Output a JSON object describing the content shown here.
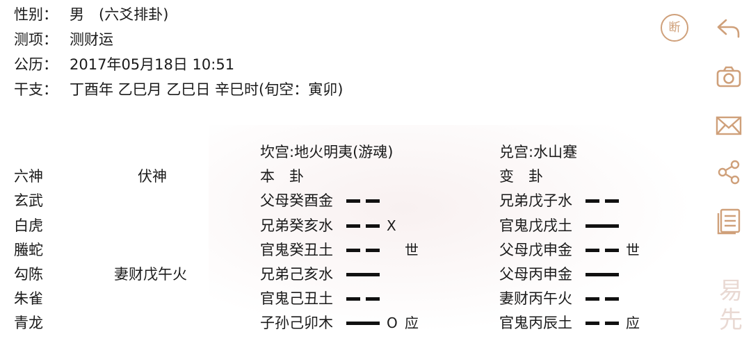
{
  "info": {
    "gender": {
      "label": "性别：",
      "value": "男　(六爻排卦)"
    },
    "topic": {
      "label": "测项：",
      "value": "测财运"
    },
    "date": {
      "label": "公历：",
      "value": "2017年05月18日 10:51"
    },
    "ganzhi": {
      "label": "干支：",
      "value": "丁酉年 乙巳月 乙巳日 辛巳时(旬空：寅卯)"
    }
  },
  "columns": {
    "liushen": "六神",
    "fushen": "伏神",
    "bengua_title": "坎宫:地火明夷(游魂)",
    "bengua": "本　卦",
    "biangua_title": "兑宫:水山蹇",
    "biangua": "变　卦"
  },
  "rows": [
    {
      "shen": "玄武",
      "fushen": "",
      "ben": "父母癸酉金",
      "ben_yin": true,
      "ben_move": "",
      "ben_mark": "",
      "bian": "兄弟戊子水",
      "bian_yin": true,
      "bian_mark": ""
    },
    {
      "shen": "白虎",
      "fushen": "",
      "ben": "兄弟癸亥水",
      "ben_yin": true,
      "ben_move": "X",
      "ben_mark": "",
      "bian": "官鬼戊戌土",
      "bian_yin": false,
      "bian_mark": ""
    },
    {
      "shen": "螣蛇",
      "fushen": "",
      "ben": "官鬼癸丑土",
      "ben_yin": true,
      "ben_move": "",
      "ben_mark": "世",
      "bian": "父母戊申金",
      "bian_yin": true,
      "bian_mark": "世"
    },
    {
      "shen": "勾陈",
      "fushen": "妻财戊午火",
      "ben": "兄弟己亥水",
      "ben_yin": false,
      "ben_move": "",
      "ben_mark": "",
      "bian": "父母丙申金",
      "bian_yin": false,
      "bian_mark": ""
    },
    {
      "shen": "朱雀",
      "fushen": "",
      "ben": "官鬼己丑土",
      "ben_yin": true,
      "ben_move": "",
      "ben_mark": "",
      "bian": "妻财丙午火",
      "bian_yin": true,
      "bian_mark": ""
    },
    {
      "shen": "青龙",
      "fushen": "",
      "ben": "子孙己卯木",
      "ben_yin": false,
      "ben_move": "O",
      "ben_mark": "应",
      "bian": "官鬼丙辰土",
      "bian_yin": true,
      "bian_mark": "应"
    }
  ],
  "toolbar": {
    "duan_label": "断",
    "icons": [
      "back-icon",
      "camera-icon",
      "mail-icon",
      "share-icon",
      "document-icon"
    ]
  },
  "watermark": "易先",
  "colors": {
    "accent": "#cfa07a",
    "text": "#1a1a1a"
  }
}
